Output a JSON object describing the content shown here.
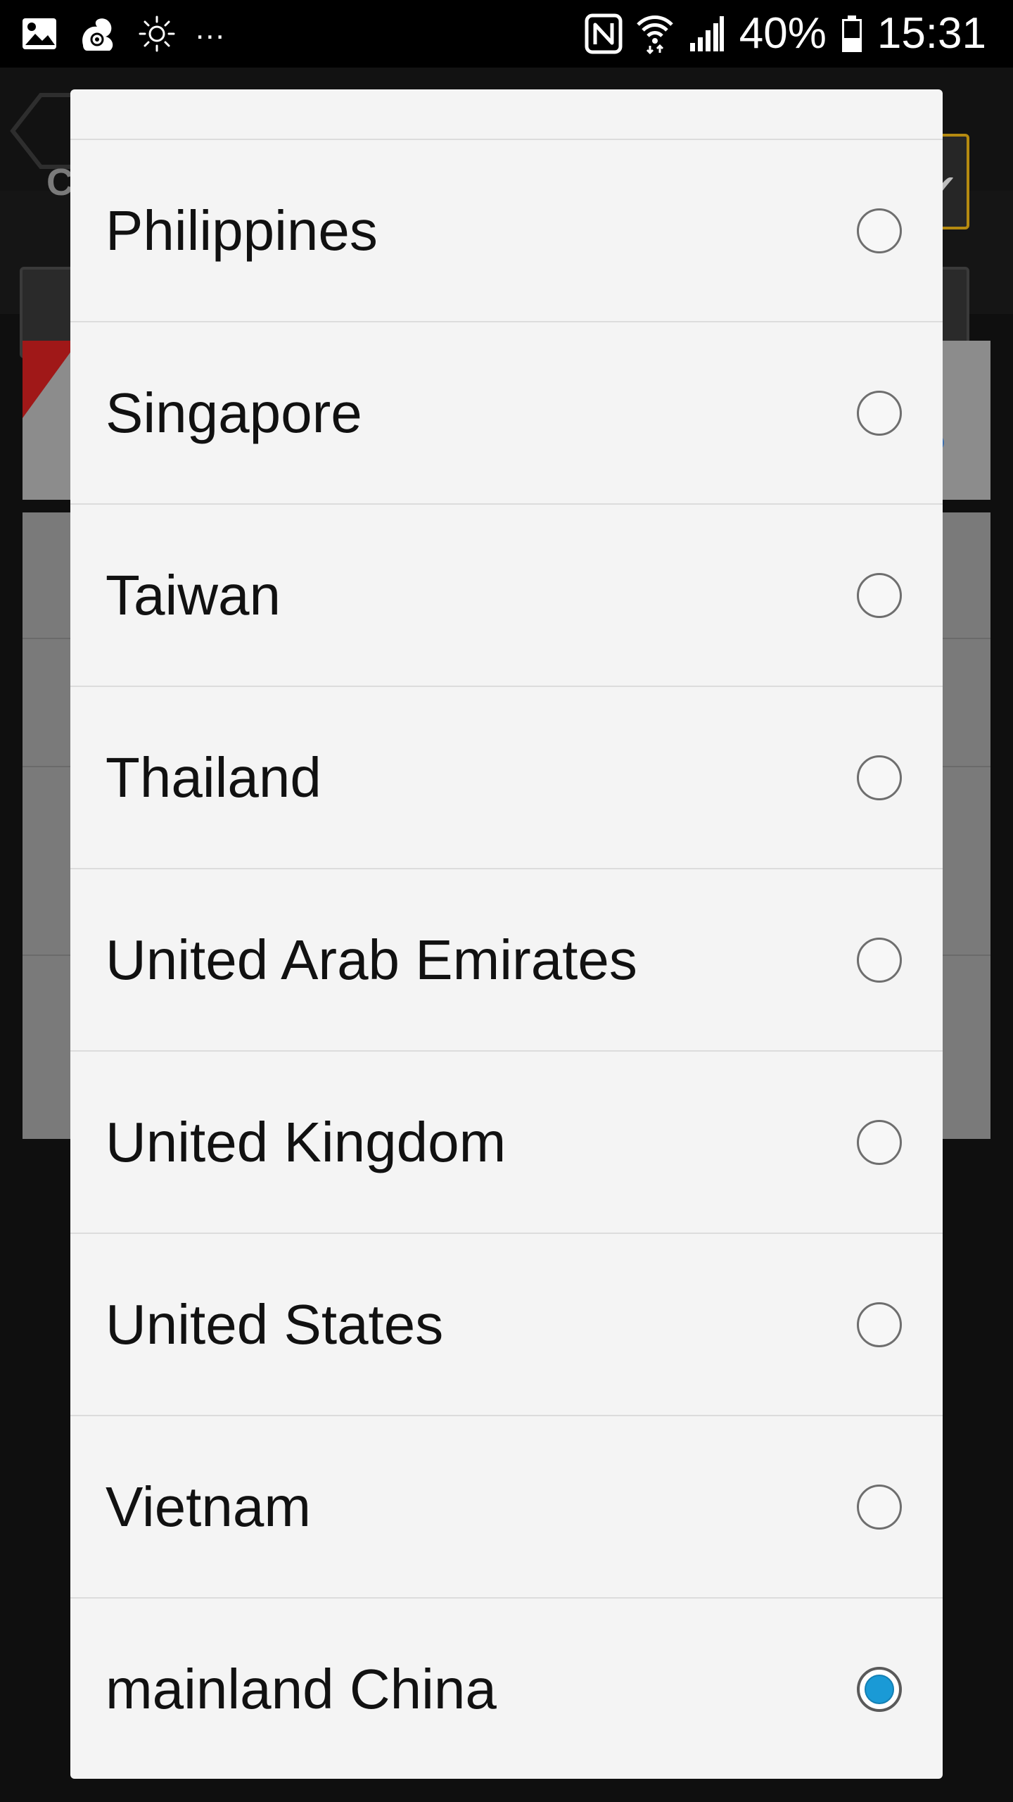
{
  "status_bar": {
    "left_icons": [
      "gallery-icon",
      "squirrel-app-icon",
      "brightness-icon"
    ],
    "overflow": "...",
    "right_icons": [
      "nfc-icon",
      "wifi-icon",
      "signal-icon",
      "battery-icon"
    ],
    "battery": "40%",
    "time": "15:31"
  },
  "background": {
    "selector_letter": "C"
  },
  "dialog": {
    "options": [
      {
        "label": "Philippines",
        "selected": false
      },
      {
        "label": "Singapore",
        "selected": false
      },
      {
        "label": "Taiwan",
        "selected": false
      },
      {
        "label": "Thailand",
        "selected": false
      },
      {
        "label": "United Arab Emirates",
        "selected": false
      },
      {
        "label": "United Kingdom",
        "selected": false
      },
      {
        "label": "United States",
        "selected": false
      },
      {
        "label": "Vietnam",
        "selected": false
      },
      {
        "label": "mainland China",
        "selected": true
      }
    ]
  },
  "colors": {
    "radio_selected": "#1a9ad6",
    "dialog_bg": "#f4f4f4",
    "accent_border": "#b58a10"
  }
}
